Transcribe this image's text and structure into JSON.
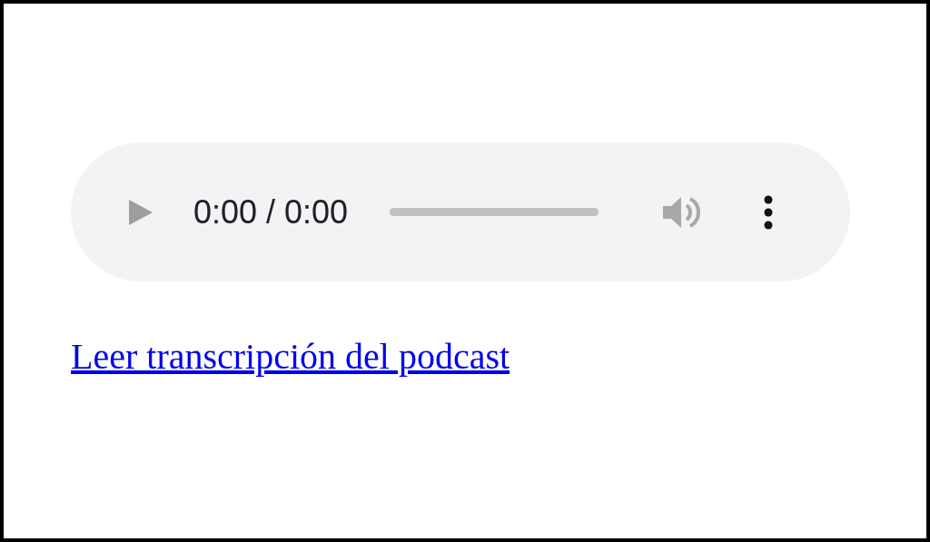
{
  "player": {
    "time": "0:00 / 0:00",
    "level": 0,
    "disabled": true
  },
  "link": {
    "text": "Leer transcripción del podcast"
  }
}
